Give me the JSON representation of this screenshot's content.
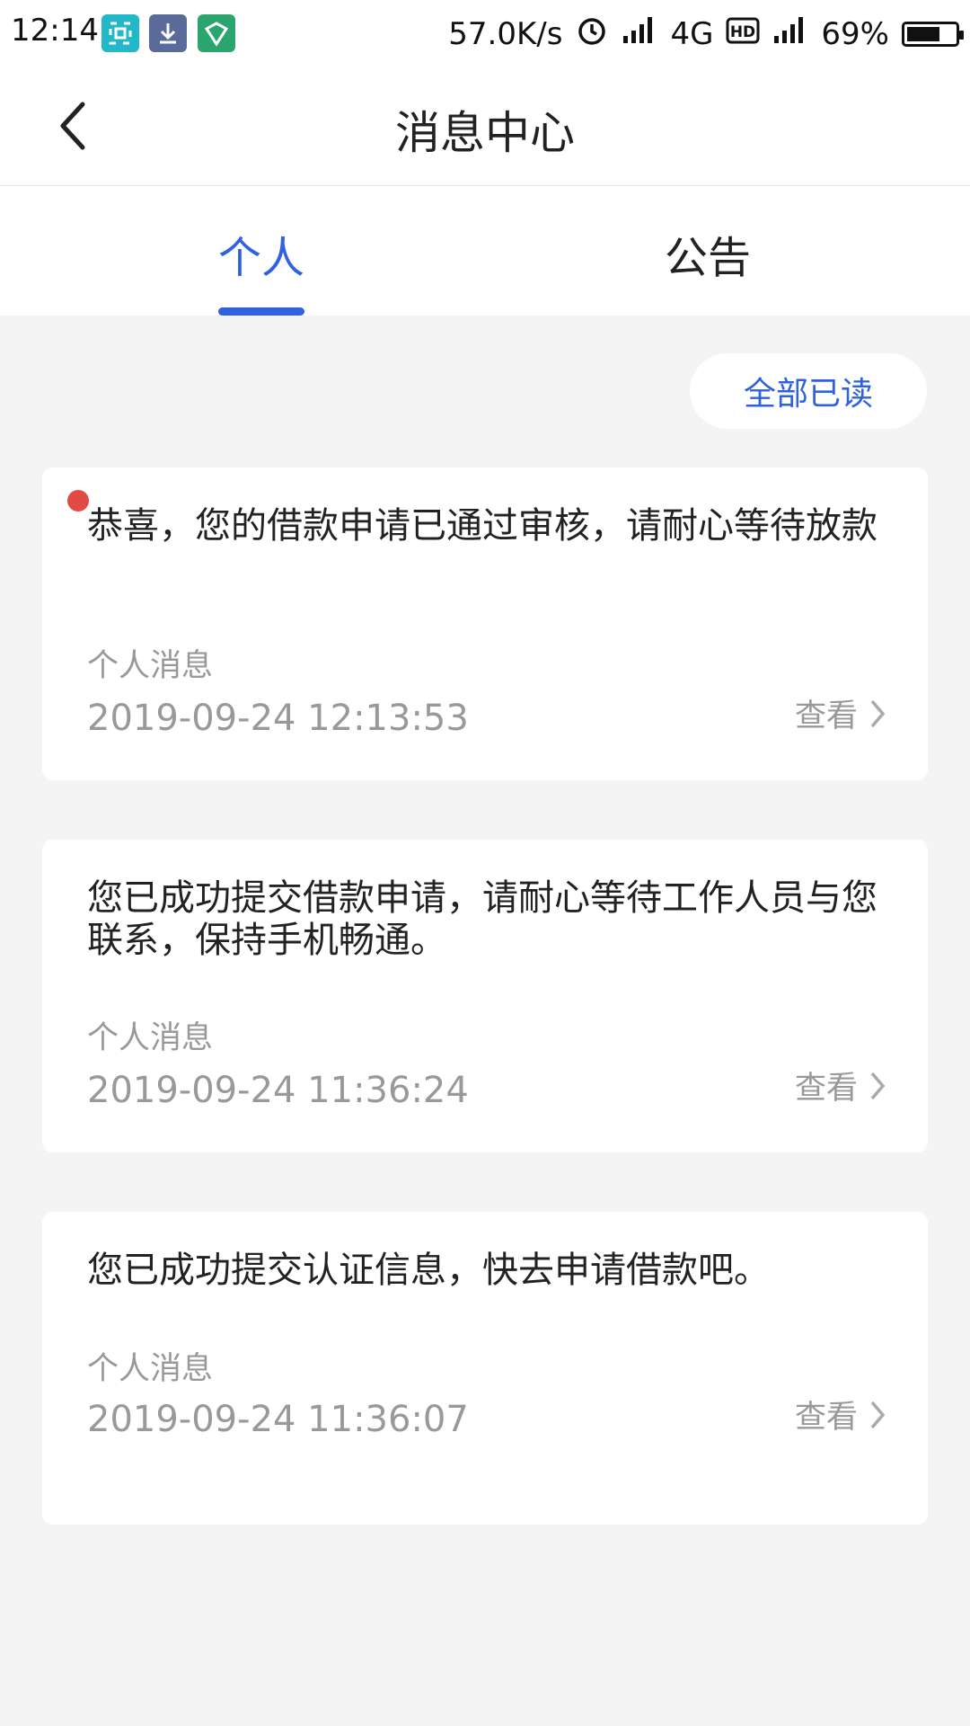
{
  "status_bar": {
    "time": "12:14",
    "net_speed": "57.0K/s",
    "network": "4G",
    "battery_percent": "69%",
    "battery_level": 0.69,
    "icons": [
      "screenshot-app-icon",
      "download-app-icon",
      "shield-app-icon",
      "alarm-icon",
      "signal-icon",
      "hd-icon",
      "signal-icon",
      "battery-icon"
    ]
  },
  "header": {
    "title": "消息中心"
  },
  "tabs": [
    {
      "label": "个人",
      "active": true
    },
    {
      "label": "公告",
      "active": false
    }
  ],
  "actions": {
    "read_all": "全部已读"
  },
  "messages": [
    {
      "title": "恭喜，您的借款申请已通过审核，请耐心等待放款",
      "type": "个人消息",
      "time": "2019-09-24 12:13:53",
      "view": "查看",
      "unread": true
    },
    {
      "title": "您已成功提交借款申请，请耐心等待工作人员与您联系，保持手机畅通。",
      "type": "个人消息",
      "time": "2019-09-24 11:36:24",
      "view": "查看",
      "unread": false
    },
    {
      "title": "您已成功提交认证信息，快去申请借款吧。",
      "type": "个人消息",
      "time": "2019-09-24 11:36:07",
      "view": "查看",
      "unread": false
    }
  ],
  "colors": {
    "accent": "#2f61e0",
    "unread_dot": "#e24b43",
    "background": "#f4f4f4"
  }
}
